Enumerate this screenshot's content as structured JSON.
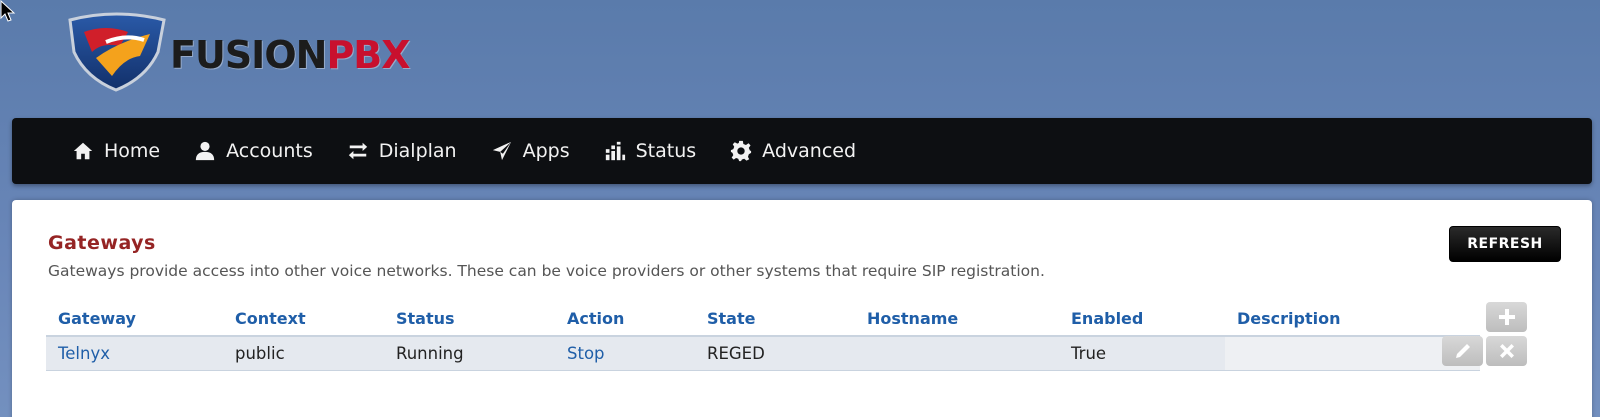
{
  "brand": {
    "fusion": "FUSION",
    "pbx": "PBX"
  },
  "nav": {
    "items": [
      {
        "label": "Home",
        "icon": "home-icon"
      },
      {
        "label": "Accounts",
        "icon": "user-icon"
      },
      {
        "label": "Dialplan",
        "icon": "transfer-icon"
      },
      {
        "label": "Apps",
        "icon": "send-icon"
      },
      {
        "label": "Status",
        "icon": "signal-icon"
      },
      {
        "label": "Advanced",
        "icon": "gear-icon"
      }
    ]
  },
  "page": {
    "title": "Gateways",
    "description": "Gateways provide access into other voice networks. These can be voice providers or other systems that require SIP registration.",
    "refresh_label": "REFRESH"
  },
  "table": {
    "headers": [
      "Gateway",
      "Context",
      "Status",
      "Action",
      "State",
      "Hostname",
      "Enabled",
      "Description"
    ],
    "rows": [
      {
        "gateway": "Telnyx",
        "context": "public",
        "status": "Running",
        "action": "Stop",
        "state": "REGED",
        "hostname": "",
        "enabled": "True",
        "description": ""
      }
    ]
  },
  "colors": {
    "accent": "#1f5ea8",
    "title": "#952424",
    "navbar": "#0d0f12",
    "brand_red": "#c8102e"
  },
  "icons": {
    "add": "plus-icon",
    "edit": "pencil-icon",
    "delete": "x-icon"
  }
}
